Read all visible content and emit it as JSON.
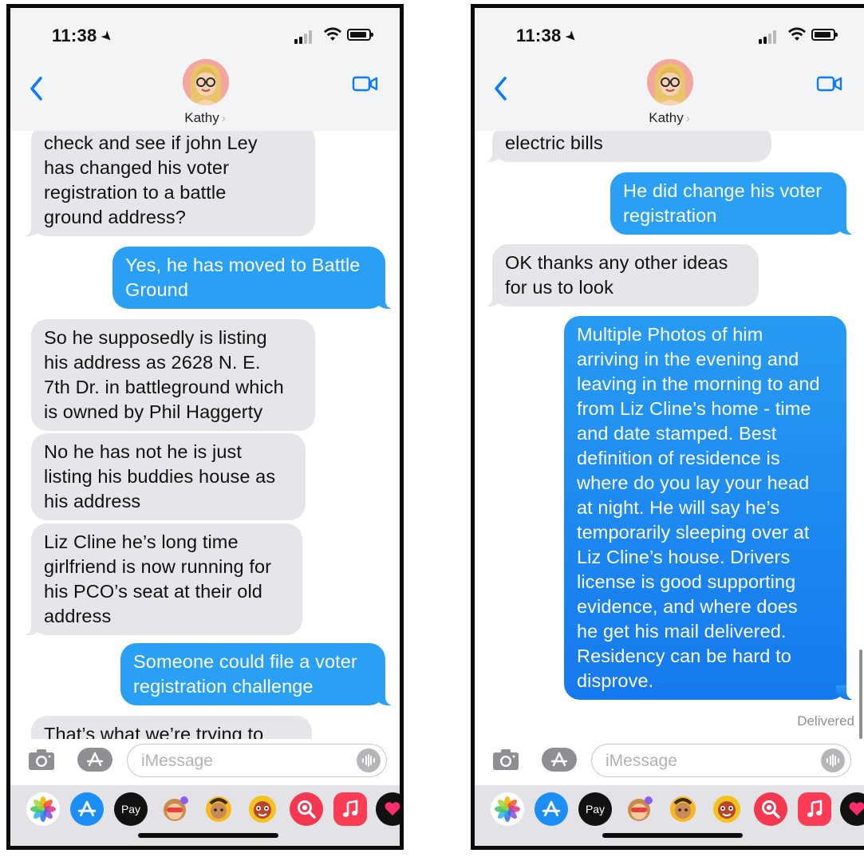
{
  "left_phone": {
    "status_time": "11:38",
    "contact_name": "Kathy",
    "messages": [
      {
        "direction": "incoming",
        "text": "check and see if john Ley\nhas changed his voter\nregistration to a battle\nground address?"
      },
      {
        "direction": "outgoing",
        "text": "Yes, he has moved to Battle\nGround"
      },
      {
        "direction": "incoming",
        "text": "So he supposedly is listing\nhis address as 2628 N. E.\n7th Dr. in battleground which\nis owned by Phil Haggerty"
      },
      {
        "direction": "incoming",
        "text": "No he has not he is just\nlisting his buddies house as\nhis address"
      },
      {
        "direction": "incoming",
        "text": "Liz Cline he’s long time\ngirlfriend is now running for\nhis PCO’s seat at their old\naddress"
      },
      {
        "direction": "outgoing",
        "text": "Someone could file a voter\nregistration challenge"
      },
      {
        "direction": "incoming",
        "text": "That’s what we’re trying to"
      }
    ],
    "input_placeholder": "iMessage"
  },
  "right_phone": {
    "status_time": "11:38",
    "contact_name": "Kathy",
    "messages": [
      {
        "direction": "incoming",
        "text": "electric bills"
      },
      {
        "direction": "outgoing",
        "text": "He did change his voter\nregistration"
      },
      {
        "direction": "incoming",
        "text": "OK thanks any other ideas\nfor us to look"
      },
      {
        "direction": "outgoing",
        "text": "Multiple Photos of him\narriving in the evening and\nleaving in the morning to and\nfrom Liz Cline’s home  - time\nand date stamped.  Best\ndefinition of residence is\nwhere do you lay your head\nat night.  He will say he’s\ntemporarily sleeping over at\nLiz Cline’s house. Drivers\nlicense is good supporting\nevidence, and where does\nhe get his mail delivered.\nResidency can be hard to\ndisprove."
      }
    ],
    "delivered_label": "Delivered",
    "input_placeholder": "iMessage"
  },
  "app_tray": {
    "apple_pay_label": "Pay",
    "icons": [
      "photos-icon",
      "app-store-icon",
      "apple-pay-icon",
      "memoji-stickers-icon",
      "memoji-icon",
      "animoji-icon",
      "images-search-icon",
      "music-icon",
      "digital-touch-icon"
    ]
  },
  "colors": {
    "incoming_bubble": "#e6e6ea",
    "outgoing_bubble": "#2aa0f5",
    "header_background": "#f3f4f6",
    "accent": "#007aff"
  }
}
